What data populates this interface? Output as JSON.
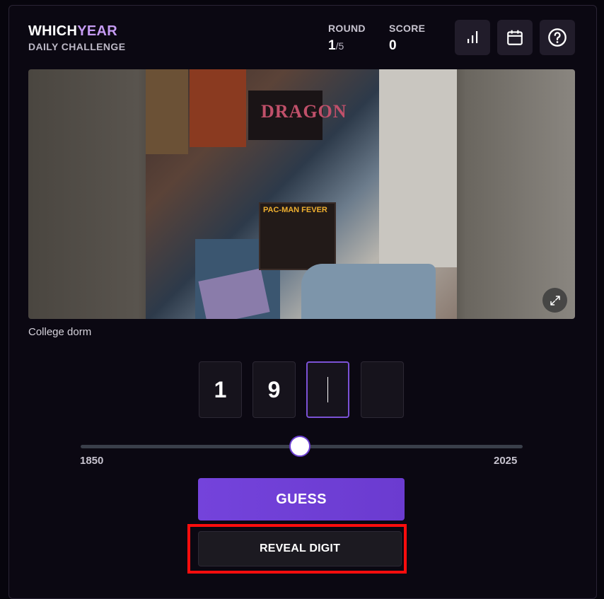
{
  "header": {
    "brand_part1": "WHICH",
    "brand_part2": "YEAR",
    "subtitle": "DAILY CHALLENGE",
    "round_label": "ROUND",
    "round_current": "1",
    "round_total": "/5",
    "score_label": "SCORE",
    "score_value": "0",
    "icons": [
      "stats-icon",
      "calendar-icon",
      "help-icon"
    ]
  },
  "photo": {
    "poster_text": "DRAGON",
    "record_text": "PAC-MAN FEVER",
    "caption": "College dorm"
  },
  "guess": {
    "digits": [
      "1",
      "9",
      "",
      ""
    ],
    "active_digit_index": 2
  },
  "slider": {
    "min_label": "1850",
    "max_label": "2025",
    "position_fraction": 0.5
  },
  "buttons": {
    "guess_label": "GUESS",
    "reveal_label": "REVEAL DIGIT"
  },
  "colors": {
    "accent": "#c59bf2",
    "primary_button": "#7443db",
    "highlight": "#ff0d0d"
  }
}
